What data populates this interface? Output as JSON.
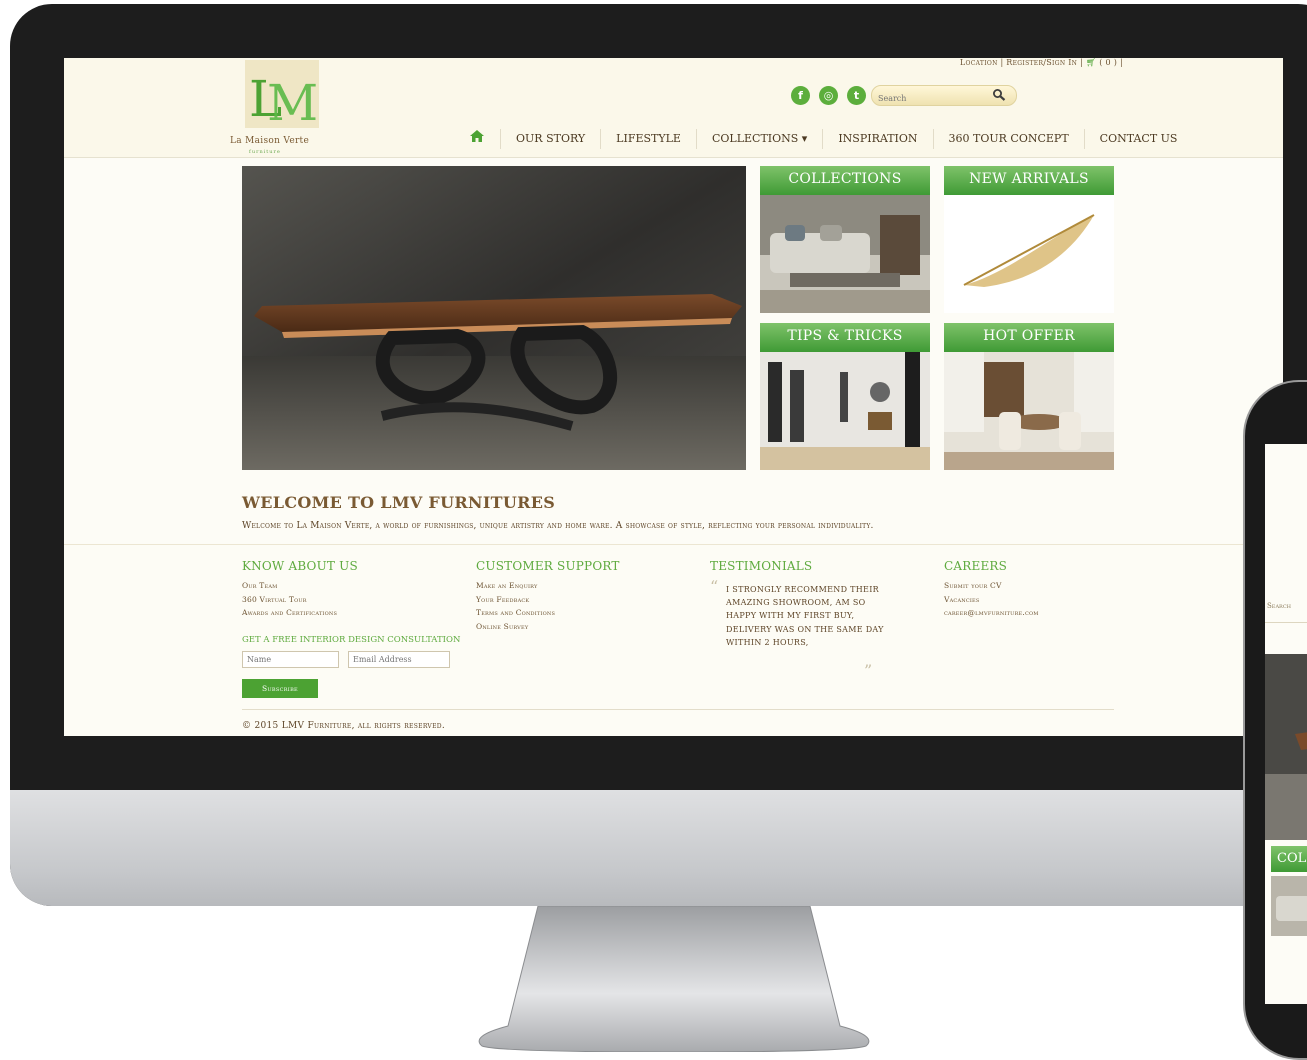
{
  "header": {
    "logo_text": "LM",
    "logo_name": "La Maison Verte",
    "logo_tagline": "furniture",
    "top_links": "Location | Register/Sign In |",
    "cart": "( 0 ) |",
    "search_placeholder": "Search"
  },
  "nav": {
    "items": [
      "OUR STORY",
      "LIFESTYLE",
      "COLLECTIONS ▾",
      "INSPIRATION",
      "360 TOUR CONCEPT",
      "CONTACT US"
    ]
  },
  "tiles": [
    "COLLECTIONS",
    "NEW ARRIVALS",
    "TIPS & TRICKS",
    "HOT OFFER"
  ],
  "welcome": {
    "title": "WELCOME TO LMV FURNITURES",
    "text": "Welcome to La Maison Verte, a world of furnishings, unique artistry and home ware. A showcase of style, reflecting your personal individuality."
  },
  "footer": {
    "about": {
      "title": "KNOW ABOUT US",
      "links": [
        "Our Team",
        "360 Virtual Tour",
        "Awards and Certifications"
      ]
    },
    "support": {
      "title": "CUSTOMER SUPPORT",
      "links": [
        "Make an Enquiry",
        "Your Feedback",
        "Terms and Conditions",
        "Online Survey"
      ]
    },
    "testimonials": {
      "title": "TESTIMONIALS",
      "quote": "I strongly recommend their amazing showroom, am so happy with my first buy, delivery was on the same day within 2 hours,"
    },
    "careers": {
      "title": "CAREERS",
      "links": [
        "Submit your CV",
        "Vacancies",
        "career@lmvfurniture.com"
      ]
    },
    "consult": "GET A FREE INTERIOR DESIGN CONSULTATION",
    "name_placeholder": "Name",
    "email_placeholder": "Email Address",
    "subscribe": "Subscribe",
    "copyright": "© 2015 LMV Furniture, all rights reserved."
  },
  "phone": {
    "search_placeholder": "Search",
    "tile": "COL"
  },
  "colors": {
    "accent_green": "#4ca233",
    "brown": "#7a5a33",
    "cream": "#fbf8ea"
  }
}
